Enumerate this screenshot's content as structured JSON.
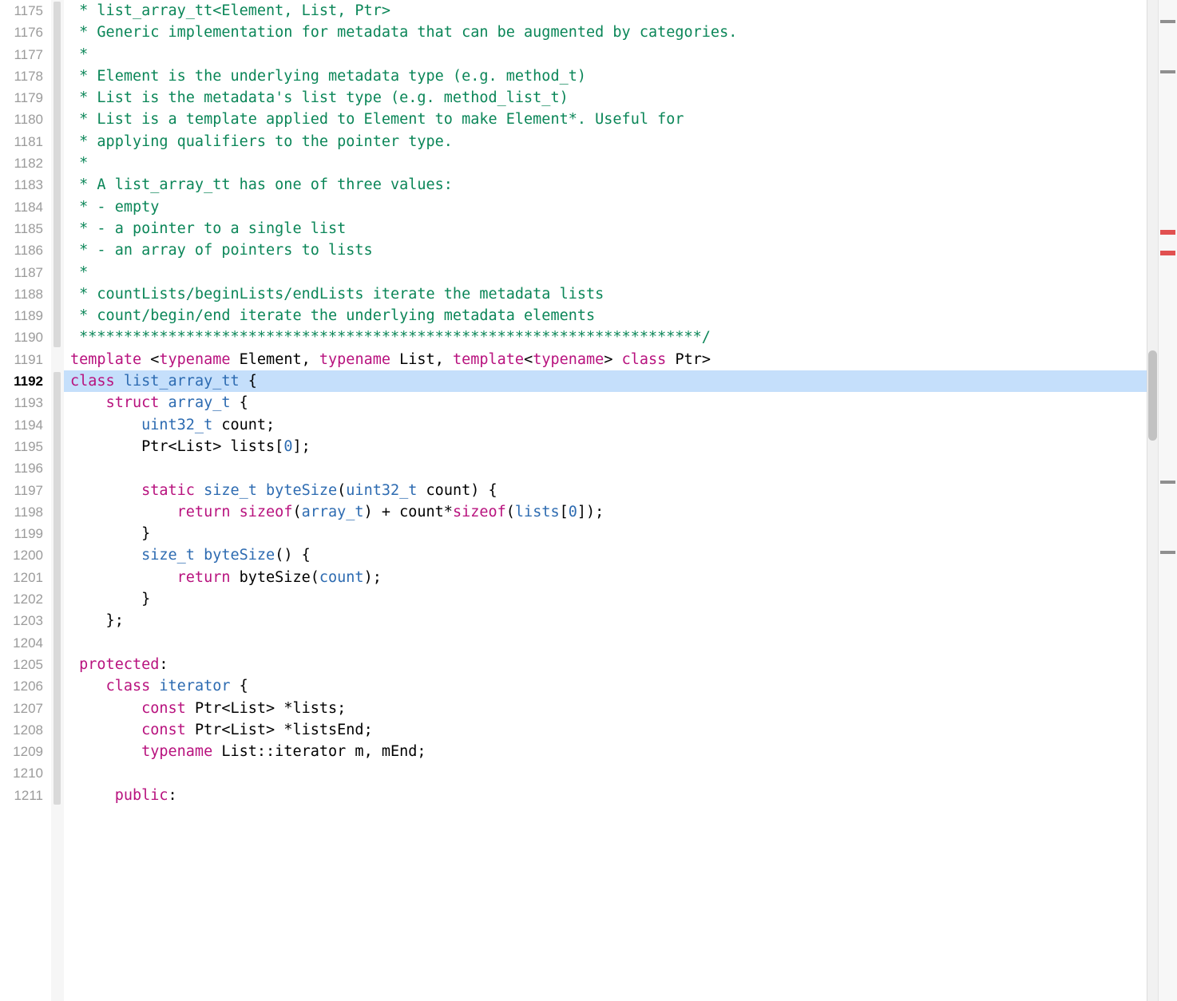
{
  "editor": {
    "first_line_number": 1175,
    "highlighted_line_number": 1192,
    "lines": [
      {
        "n": 1175,
        "tokens": [
          [
            "c-comment",
            " * list_array_tt<Element, List, Ptr>"
          ]
        ]
      },
      {
        "n": 1176,
        "tokens": [
          [
            "c-comment",
            " * Generic implementation for metadata that can be augmented by categories."
          ]
        ]
      },
      {
        "n": 1177,
        "tokens": [
          [
            "c-comment",
            " *"
          ]
        ]
      },
      {
        "n": 1178,
        "tokens": [
          [
            "c-comment",
            " * Element is the underlying metadata type (e.g. method_t)"
          ]
        ]
      },
      {
        "n": 1179,
        "tokens": [
          [
            "c-comment",
            " * List is the metadata's list type (e.g. method_list_t)"
          ]
        ]
      },
      {
        "n": 1180,
        "tokens": [
          [
            "c-comment",
            " * List is a template applied to Element to make Element*. Useful for"
          ]
        ]
      },
      {
        "n": 1181,
        "tokens": [
          [
            "c-comment",
            " * applying qualifiers to the pointer type."
          ]
        ]
      },
      {
        "n": 1182,
        "tokens": [
          [
            "c-comment",
            " *"
          ]
        ]
      },
      {
        "n": 1183,
        "tokens": [
          [
            "c-comment",
            " * A list_array_tt has one of three values:"
          ]
        ]
      },
      {
        "n": 1184,
        "tokens": [
          [
            "c-comment",
            " * - empty"
          ]
        ]
      },
      {
        "n": 1185,
        "tokens": [
          [
            "c-comment",
            " * - a pointer to a single list"
          ]
        ]
      },
      {
        "n": 1186,
        "tokens": [
          [
            "c-comment",
            " * - an array of pointers to lists"
          ]
        ]
      },
      {
        "n": 1187,
        "tokens": [
          [
            "c-comment",
            " *"
          ]
        ]
      },
      {
        "n": 1188,
        "tokens": [
          [
            "c-comment",
            " * countLists/beginLists/endLists iterate the metadata lists"
          ]
        ]
      },
      {
        "n": 1189,
        "tokens": [
          [
            "c-comment",
            " * count/begin/end iterate the underlying metadata elements"
          ]
        ]
      },
      {
        "n": 1190,
        "tokens": [
          [
            "c-comment",
            " **********************************************************************/"
          ]
        ]
      },
      {
        "n": 1191,
        "tokens": [
          [
            "c-keyword",
            "template"
          ],
          [
            "c-plain",
            " <"
          ],
          [
            "c-keyword",
            "typename"
          ],
          [
            "c-plain",
            " Element, "
          ],
          [
            "c-keyword",
            "typename"
          ],
          [
            "c-plain",
            " List, "
          ],
          [
            "c-keyword",
            "template"
          ],
          [
            "c-plain",
            "<"
          ],
          [
            "c-keyword",
            "typename"
          ],
          [
            "c-plain",
            "> "
          ],
          [
            "c-keyword",
            "class"
          ],
          [
            "c-plain",
            " Ptr>"
          ]
        ]
      },
      {
        "n": 1192,
        "highlight": true,
        "tokens": [
          [
            "c-keyword",
            "class"
          ],
          [
            "c-plain",
            " "
          ],
          [
            "c-type",
            "list_array_tt"
          ],
          [
            "c-plain",
            " {"
          ]
        ]
      },
      {
        "n": 1193,
        "tokens": [
          [
            "c-plain",
            "    "
          ],
          [
            "c-keyword",
            "struct"
          ],
          [
            "c-plain",
            " "
          ],
          [
            "c-type",
            "array_t"
          ],
          [
            "c-plain",
            " {"
          ]
        ]
      },
      {
        "n": 1194,
        "tokens": [
          [
            "c-plain",
            "        "
          ],
          [
            "c-type",
            "uint32_t"
          ],
          [
            "c-plain",
            " count;"
          ]
        ]
      },
      {
        "n": 1195,
        "tokens": [
          [
            "c-plain",
            "        Ptr<List> lists["
          ],
          [
            "c-type",
            "0"
          ],
          [
            "c-plain",
            "];"
          ]
        ]
      },
      {
        "n": 1196,
        "tokens": [
          [
            "c-plain",
            ""
          ]
        ]
      },
      {
        "n": 1197,
        "tokens": [
          [
            "c-plain",
            "        "
          ],
          [
            "c-keyword",
            "static"
          ],
          [
            "c-plain",
            " "
          ],
          [
            "c-type",
            "size_t"
          ],
          [
            "c-plain",
            " "
          ],
          [
            "c-func",
            "byteSize"
          ],
          [
            "c-plain",
            "("
          ],
          [
            "c-type",
            "uint32_t"
          ],
          [
            "c-plain",
            " count) {"
          ]
        ]
      },
      {
        "n": 1198,
        "tokens": [
          [
            "c-plain",
            "            "
          ],
          [
            "c-keyword",
            "return"
          ],
          [
            "c-plain",
            " "
          ],
          [
            "c-keyword",
            "sizeof"
          ],
          [
            "c-plain",
            "("
          ],
          [
            "c-type",
            "array_t"
          ],
          [
            "c-plain",
            ") + count*"
          ],
          [
            "c-keyword",
            "sizeof"
          ],
          [
            "c-plain",
            "("
          ],
          [
            "c-type",
            "lists"
          ],
          [
            "c-plain",
            "["
          ],
          [
            "c-type",
            "0"
          ],
          [
            "c-plain",
            "]);"
          ]
        ]
      },
      {
        "n": 1199,
        "tokens": [
          [
            "c-plain",
            "        }"
          ]
        ]
      },
      {
        "n": 1200,
        "tokens": [
          [
            "c-plain",
            "        "
          ],
          [
            "c-type",
            "size_t"
          ],
          [
            "c-plain",
            " "
          ],
          [
            "c-func",
            "byteSize"
          ],
          [
            "c-plain",
            "() {"
          ]
        ]
      },
      {
        "n": 1201,
        "tokens": [
          [
            "c-plain",
            "            "
          ],
          [
            "c-keyword",
            "return"
          ],
          [
            "c-plain",
            " byteSize("
          ],
          [
            "c-type",
            "count"
          ],
          [
            "c-plain",
            ");"
          ]
        ]
      },
      {
        "n": 1202,
        "tokens": [
          [
            "c-plain",
            "        }"
          ]
        ]
      },
      {
        "n": 1203,
        "tokens": [
          [
            "c-plain",
            "    };"
          ]
        ]
      },
      {
        "n": 1204,
        "tokens": [
          [
            "c-plain",
            ""
          ]
        ]
      },
      {
        "n": 1205,
        "tokens": [
          [
            "c-plain",
            " "
          ],
          [
            "c-keyword",
            "protected"
          ],
          [
            "c-plain",
            ":"
          ]
        ]
      },
      {
        "n": 1206,
        "tokens": [
          [
            "c-plain",
            "    "
          ],
          [
            "c-keyword",
            "class"
          ],
          [
            "c-plain",
            " "
          ],
          [
            "c-type",
            "iterator"
          ],
          [
            "c-plain",
            " {"
          ]
        ]
      },
      {
        "n": 1207,
        "tokens": [
          [
            "c-plain",
            "        "
          ],
          [
            "c-keyword",
            "const"
          ],
          [
            "c-plain",
            " Ptr<List> *lists;"
          ]
        ]
      },
      {
        "n": 1208,
        "tokens": [
          [
            "c-plain",
            "        "
          ],
          [
            "c-keyword",
            "const"
          ],
          [
            "c-plain",
            " Ptr<List> *listsEnd;"
          ]
        ]
      },
      {
        "n": 1209,
        "tokens": [
          [
            "c-plain",
            "        "
          ],
          [
            "c-keyword",
            "typename"
          ],
          [
            "c-plain",
            " List::iterator m, mEnd;"
          ]
        ]
      },
      {
        "n": 1210,
        "tokens": [
          [
            "c-plain",
            ""
          ]
        ]
      },
      {
        "n": 1211,
        "tokens": [
          [
            "c-plain",
            "     "
          ],
          [
            "c-keyword",
            "public"
          ],
          [
            "c-plain",
            ":"
          ]
        ]
      }
    ],
    "fold_regions": [
      {
        "start": 1175,
        "end": 1190
      },
      {
        "start": 1192,
        "end": 1211
      },
      {
        "start": 1197,
        "end": 1203
      }
    ]
  },
  "overview_marks": [
    {
      "top_pct": 2,
      "kind": "plain"
    },
    {
      "top_pct": 7,
      "kind": "plain"
    },
    {
      "top_pct": 23,
      "kind": "red"
    },
    {
      "top_pct": 25,
      "kind": "red"
    },
    {
      "top_pct": 48,
      "kind": "plain"
    },
    {
      "top_pct": 55,
      "kind": "plain"
    }
  ],
  "scrollbar": {
    "thumb_top_pct": 35,
    "thumb_height_pct": 9
  }
}
